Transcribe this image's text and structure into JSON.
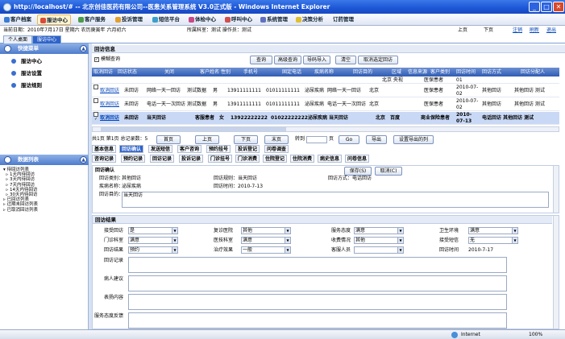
{
  "window": {
    "title": "http://localhost/# -- 北京创佳医药有限公司--医患关系管理系统 V3.0正式版 - Windows Internet Explorer",
    "min": "_",
    "max": "□",
    "close": "✕"
  },
  "menu": {
    "items": [
      "客户档案",
      "服访中心",
      "客户服务",
      "投诉管理",
      "短信平台",
      "体检中心",
      "呼叫中心",
      "系统管理",
      "决策分析",
      "订药管理"
    ],
    "active_index": 1
  },
  "datebar": {
    "date": "当前日期：2010年7月17日 星期六 农历庚寅年 六月初六",
    "dept": "所属科室：测试 操作员：测试",
    "prev": "上页",
    "next": "下页",
    "logout": "注销",
    "refresh": "刷新",
    "exit": "退出"
  },
  "tabs": [
    "个人桌面",
    "服访中心"
  ],
  "sidebar": {
    "head1": "快捷菜单",
    "items": [
      "服访中心",
      "服访设置",
      "服访规则"
    ],
    "head2": "数据列表",
    "tree": [
      "▾ 待回访列表",
      "  ▹ 1天内待回访",
      "  ▹ 3天内待回访",
      "  ▹ 7天内待回访",
      "  ▹ 14天内待回访",
      "  ▹ 30天内待回访",
      "▹ 已回访列表",
      "▹ 过期未回访列表",
      "▹ 已取消回访列表"
    ]
  },
  "panel": {
    "title": "回访信息",
    "show_check": "模糊查询",
    "buttons": [
      "查询",
      "高级查询",
      "导码导入",
      "清空",
      "取消选定回访"
    ]
  },
  "grid": {
    "headers": [
      "取消回访",
      "回访状态",
      "关闭",
      "客户姓名",
      "性别",
      "手机号",
      "固定电话",
      "疾病名称",
      "回访目的",
      "区域",
      "信息来源",
      "客户类别",
      "回访时间",
      "回访方式",
      "回访分配人"
    ],
    "rows": [
      [
        "",
        "",
        "",
        "",
        "",
        "",
        "",
        "",
        "",
        "",
        "",
        "",
        "01",
        "",
        ""
      ],
      [
        "",
        "取消回访",
        "未回访",
        "网络一天一回访",
        "测试数据",
        "男",
        "13911111111",
        "01011111111",
        "泌尿疾病",
        "网络一天一回访",
        "北京",
        "医保患者",
        "2010-07-02",
        "其他回访",
        "其他回访 测试"
      ],
      [
        "",
        "取消回访",
        "未回访",
        "电话一天一次回访",
        "测试数据",
        "男",
        "13911111111",
        "01011111111",
        "泌尿疾病",
        "电话一天一次回访",
        "北京",
        "医保患者",
        "2010-07-02",
        "其他回访",
        "其他回访 测试"
      ],
      [
        "✓",
        "取消回访",
        "未回访",
        "当天回访",
        "客服患者",
        "女",
        "13922222222",
        "01022222222",
        "泌尿疾病",
        "当天回访",
        "北京",
        "百度",
        "商业保险患者",
        "2010-07-13",
        "电话回访 其他回访 测试"
      ]
    ],
    "row0_partial": [
      "泌尿疾病",
      "北京 央视",
      "医保患者"
    ]
  },
  "pager": {
    "info": "共1页 第1页 总记录数：5",
    "first": "首页",
    "prev": "上页",
    "next": "下页",
    "last": "末页",
    "goto": "转到",
    "page": "页",
    "go": "Go",
    "export": "导出",
    "setcols": "设置导出的列"
  },
  "subtabs1": [
    "基本信息",
    "回访确认",
    "发送短信",
    "客户咨询",
    "预约挂号",
    "投诉登记",
    "问卷调查"
  ],
  "subtabs2": [
    "咨询记录",
    "预约记录",
    "回访记录",
    "投诉记录",
    "门诊挂号",
    "门诊消费",
    "住院登记",
    "住院消费",
    "病史信息",
    "问卷信息"
  ],
  "confirm": {
    "title": "回访确认",
    "save": "保存(S)",
    "cancel": "取消(C)",
    "type_label": "回访类别：",
    "type_value": "其他回访",
    "rule_label": "回访规则：",
    "rule_value": "当天回访",
    "method_label": "回访方式：",
    "method_value": "电话回访",
    "disease_label": "疾病名称：",
    "disease_value": "泌尿疾病",
    "time_label": "回访时间：",
    "time_value": "2010-7-13",
    "purpose_label": "回访目的：",
    "purpose_value": "当天回访"
  },
  "result": {
    "title": "回访结果",
    "fields": [
      {
        "label": "接受回访",
        "value": "是"
      },
      {
        "label": "复诊医院",
        "value": "其他"
      },
      {
        "label": "服务态度",
        "value": "满意"
      },
      {
        "label": "卫生环境",
        "value": "满意"
      },
      {
        "label": "门诊科室",
        "value": "满意"
      },
      {
        "label": "医技科室",
        "value": "满意"
      },
      {
        "label": "收费情况",
        "value": "其他"
      },
      {
        "label": "接受短信",
        "value": "无"
      },
      {
        "label": "回访结果",
        "value": "预约"
      },
      {
        "label": "治疗效果",
        "value": "一般"
      },
      {
        "label": "客服人员",
        "value": ""
      },
      {
        "label": "回访时间",
        "value": "2010-7-17"
      }
    ],
    "notes": [
      "回访记录",
      "病人建议",
      "表扬内容",
      "服务态度反馈"
    ]
  },
  "status": {
    "zone": "Internet",
    "zoom": "100%"
  }
}
